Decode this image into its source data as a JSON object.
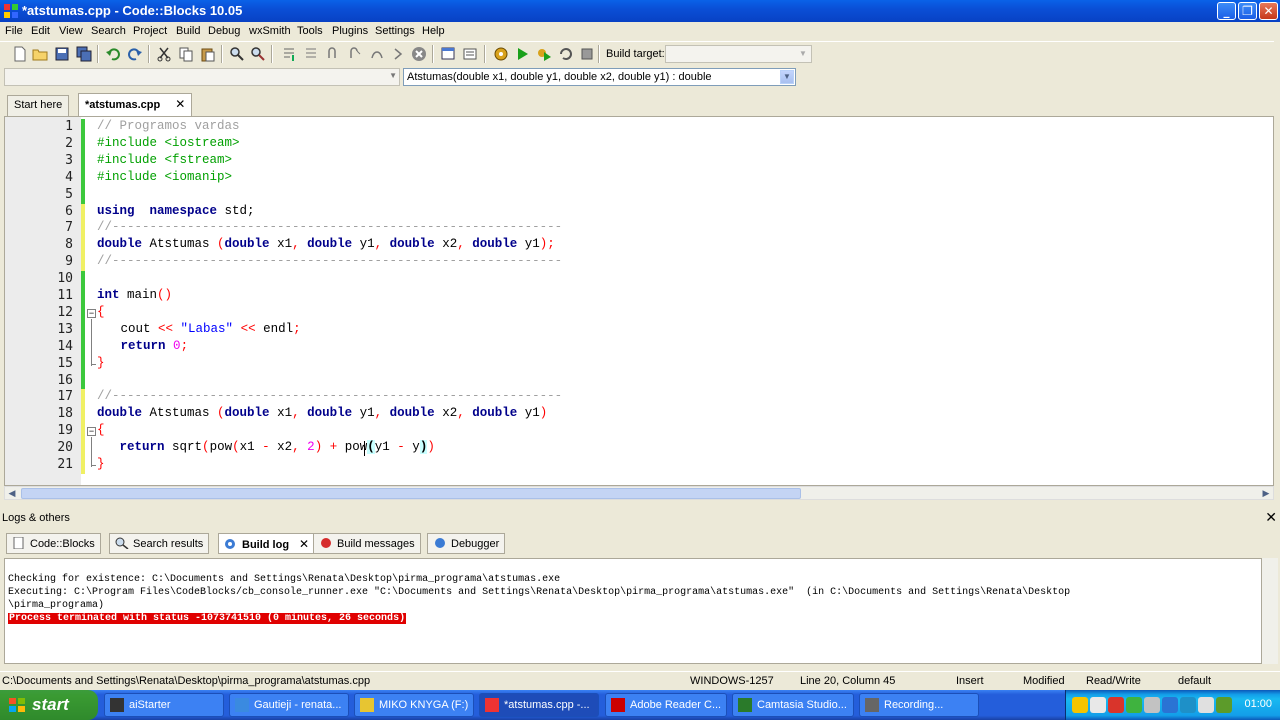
{
  "window": {
    "title": "*atstumas.cpp - Code::Blocks 10.05"
  },
  "menu": [
    "File",
    "Edit",
    "View",
    "Search",
    "Project",
    "Build",
    "Debug",
    "wxSmith",
    "Tools",
    "Plugins",
    "Settings",
    "Help"
  ],
  "toolbar": {
    "build_target_label": "Build target:",
    "build_target_value": "",
    "icons": [
      "new-file-icon",
      "open-icon",
      "save-icon",
      "save-all-icon",
      "undo-icon",
      "redo-icon",
      "cut-icon",
      "copy-icon",
      "paste-icon",
      "find-icon",
      "replace-icon",
      "debug-run-to-cursor-icon",
      "debug-next-line-icon",
      "debug-step-into-icon",
      "debug-step-out-icon",
      "debug-next-instruction-icon",
      "debug-stop-icon",
      "debug-windows-icon",
      "debug-info-icon",
      "build-icon",
      "run-icon",
      "build-and-run-icon",
      "rebuild-icon",
      "abort-icon"
    ]
  },
  "code_toolbar": {
    "scope": "",
    "function": "Atstumas(double x1, double y1, double x2, double y1) : double"
  },
  "editor_tabs": [
    {
      "label": "Start here",
      "active": false
    },
    {
      "label": "*atstumas.cpp",
      "active": true,
      "close": "✕"
    }
  ],
  "editor": {
    "line_numbers": [
      "1",
      "2",
      "3",
      "4",
      "5",
      "6",
      "7",
      "8",
      "9",
      "10",
      "11",
      "12",
      "13",
      "14",
      "15",
      "16",
      "17",
      "18",
      "19",
      "20",
      "21"
    ]
  },
  "logs": {
    "title": "Logs & others",
    "close": "✕",
    "tabs": [
      {
        "label": "Code::Blocks",
        "active": false
      },
      {
        "label": "Search results",
        "active": false
      },
      {
        "label": "Build log",
        "active": true,
        "close": "✕"
      },
      {
        "label": "Build messages",
        "active": false
      },
      {
        "label": "Debugger",
        "active": false
      }
    ],
    "lines": [
      "Checking for existence: C:\\Documents and Settings\\Renata\\Desktop\\pirma_programa\\atstumas.exe",
      "Executing: C:\\Program Files\\CodeBlocks/cb_console_runner.exe \"C:\\Documents and Settings\\Renata\\Desktop\\pirma_programa\\atstumas.exe\"  (in C:\\Documents and Settings\\Renata\\Desktop",
      "\\pirma_programa)",
      "Process terminated with status -1073741510 (0 minutes, 26 seconds)"
    ]
  },
  "status": {
    "path": "C:\\Documents and Settings\\Renata\\Desktop\\pirma_programa\\atstumas.cpp",
    "encoding": "WINDOWS-1257",
    "position": "Line 20, Column 45",
    "mode": "Insert",
    "modified": "Modified",
    "access": "Read/Write",
    "lang": "default"
  },
  "taskbar": {
    "start": "start",
    "tasks": [
      {
        "label": "aiStarter",
        "active": false
      },
      {
        "label": "Gautieji - renata...",
        "active": false
      },
      {
        "label": "MIKO KNYGA (F:)",
        "active": false
      },
      {
        "label": "*atstumas.cpp -...",
        "active": true
      },
      {
        "label": "Adobe Reader C...",
        "active": false
      },
      {
        "label": "Camtasia Studio...",
        "active": false
      },
      {
        "label": "Recording...",
        "active": false
      }
    ],
    "clock": "01:00"
  },
  "colors": {
    "titlebar": "#0a4fd6",
    "comment": "#a0a0a0",
    "preprocessor": "#00a000",
    "keyword": "#00008b",
    "operator": "#ff0000",
    "string": "#0000ff",
    "number": "#f000f0",
    "error_line": "#e00000",
    "changebar_saved": "#3cc83c",
    "changebar_modified": "#f0f064"
  }
}
